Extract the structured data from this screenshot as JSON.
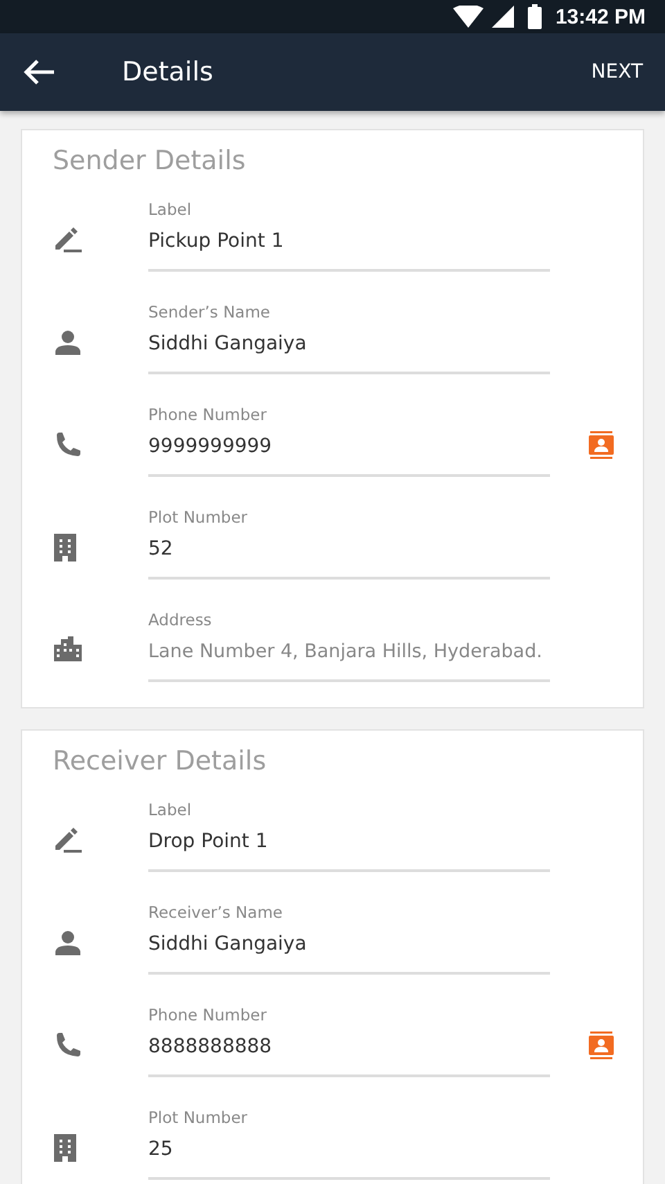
{
  "status_bar": {
    "time": "13:42 PM"
  },
  "app_bar": {
    "title": "Details",
    "action": "NEXT"
  },
  "sections": [
    {
      "title": "Sender Details",
      "fields": [
        {
          "kind": "label",
          "label": "Label",
          "value": "Pickup Point 1"
        },
        {
          "kind": "person",
          "label": "Sender’s Name",
          "value": "Siddhi Gangaiya"
        },
        {
          "kind": "phone",
          "label": "Phone Number",
          "value": "9999999999"
        },
        {
          "kind": "plot",
          "label": "Plot Number",
          "value": "52"
        },
        {
          "kind": "address",
          "label": "Address",
          "placeholder": "Lane Number 4, Banjara Hills, Hyderabad."
        }
      ]
    },
    {
      "title": "Receiver Details",
      "fields": [
        {
          "kind": "label",
          "label": "Label",
          "value": "Drop Point 1"
        },
        {
          "kind": "person",
          "label": "Receiver’s Name",
          "value": "Siddhi Gangaiya"
        },
        {
          "kind": "phone",
          "label": "Phone Number",
          "value": "8888888888"
        },
        {
          "kind": "plot",
          "label": "Plot Number",
          "value": "25"
        }
      ]
    }
  ]
}
